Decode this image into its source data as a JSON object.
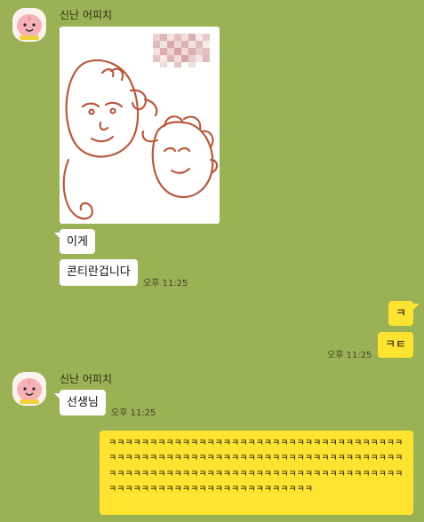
{
  "chat": {
    "group1": {
      "sender": "신난 어피치",
      "avatar_icon": "apeach-avatar-icon",
      "photo_icon": "cartoon-drawing-image",
      "messages": [
        {
          "text": "이게"
        },
        {
          "text": "콘티란겁니다",
          "time": "오후 11:25"
        }
      ]
    },
    "mine1": {
      "messages": [
        {
          "text": "ㅋ"
        },
        {
          "text": "ㅋㅌ",
          "time": "오후 11:25"
        }
      ]
    },
    "group2": {
      "sender": "신난 어피치",
      "avatar_icon": "apeach-avatar-icon",
      "messages": [
        {
          "text": "선생님",
          "time": "오후 11:25"
        }
      ]
    },
    "mine2": {
      "text": "ㅋㅋㅋㅋㅋㅋㅋㅋㅋㅋㅋㅋㅋㅋㅋㅋㅋㅋㅋㅋㅋㅋㅋㅋㅋㅋㅋㅋㅋㅋㅋㅋㅋㅋㅋㅋㅋㅋㅋㅋㅋㅋㅋㅋㅋㅋㅋㅋㅋㅋㅋㅋㅋㅋㅋㅋㅋㅋㅋㅋㅋㅋㅋㅋㅋㅋㅋㅋㅋㅋㅋㅋㅋㅋㅋㅋㅋㅋㅋㅋㅋㅋㅋㅋㅋㅋㅋㅋㅋㅋㅋㅋㅋㅋㅋㅋㅋㅋㅋㅋㅋㅋㅋㅋㅋㅋㅋㅋㅋㅋㅋㅋㅋㅋㅋㅋㅋㅋㅋㅋㅋㅋㅋㅋㅋㅋㅋㅋㅋㅋㅋㅋㅋ"
    }
  },
  "colors": {
    "background": "#9bb155",
    "my_bubble": "#fee330",
    "other_bubble": "#ffffff",
    "drawing_stroke": "#b85a3c"
  }
}
